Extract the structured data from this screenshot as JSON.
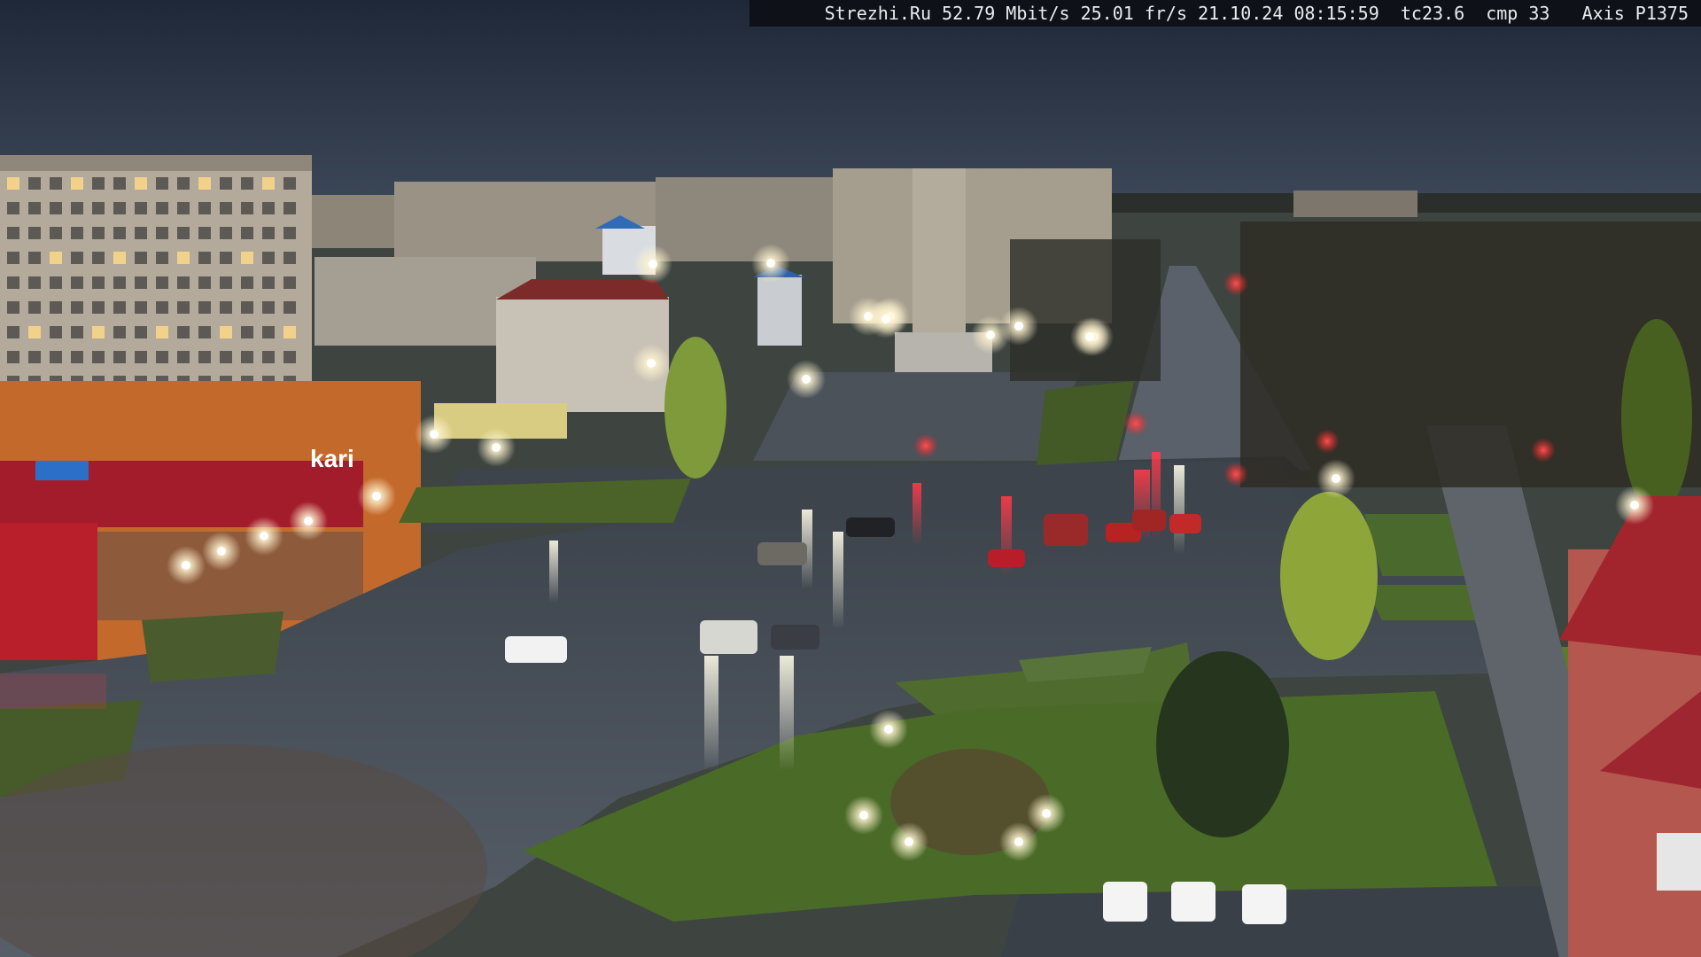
{
  "camera_overlay": {
    "site": "Strezhi.Ru",
    "bitrate": "52.79 Mbit/s",
    "framerate": "25.01 fr/s",
    "date": "21.10.24",
    "time": "08:15:59",
    "tc": "tc23.6",
    "cmp": "cmp 33",
    "model": "Axis P1375"
  },
  "signage": {
    "store_sign": "kari"
  },
  "colors": {
    "sky": "#2b3546",
    "sky_low": "#3b4657",
    "road_wet": "#4a525c",
    "grass": "#4f6b2e",
    "building_light": "#b9b0a2",
    "store_orange": "#c4692c",
    "store_red": "#b21e2a",
    "brake_light": "#ff2a2a",
    "street_light": "#fff6d9"
  }
}
